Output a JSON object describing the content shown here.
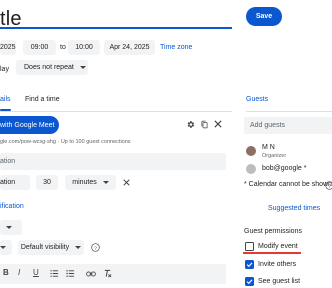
{
  "header": {
    "title": "tle",
    "save_label": "Save"
  },
  "datetime": {
    "start_date": "2025",
    "start_time": "09:00",
    "to_label": "to",
    "end_time": "10:00",
    "end_date": "Apr 24, 2025",
    "timezone_label": "Time zone",
    "allday_label": "lay",
    "repeat_value": "Does not repeat"
  },
  "tabs": {
    "details_label": "ails",
    "find_time_label": "Find a time"
  },
  "meet": {
    "button_label": "with Google Meet",
    "link_text": "gle.com/pow-wcsg-shg · Up to 100 guest connections"
  },
  "location": {
    "placeholder": "ation"
  },
  "notification": {
    "type_value": "ation",
    "amount_value": "30",
    "unit_value": "minutes",
    "add_label": "ification"
  },
  "visibility": {
    "value": "Default visibility"
  },
  "formatting": {
    "bold": "B",
    "italic": "I",
    "underline": "U"
  },
  "guests": {
    "header": "Guests",
    "add_placeholder": "Add guests",
    "list": [
      {
        "name": "M N",
        "role": "Organizer",
        "avatar_color": "#8d6e63"
      },
      {
        "name": "bob@google *",
        "role": "",
        "avatar_color": "#bdbdbd"
      }
    ],
    "calendar_note": "* Calendar cannot be shown",
    "suggested_times": "Suggested times",
    "permissions_title": "Guest permissions",
    "permissions": [
      {
        "label": "Modify event",
        "checked": false
      },
      {
        "label": "Invite others",
        "checked": true
      },
      {
        "label": "See guest list",
        "checked": true
      }
    ]
  },
  "colors": {
    "accent": "#0b57d0",
    "annotation_red": "#e53935"
  }
}
